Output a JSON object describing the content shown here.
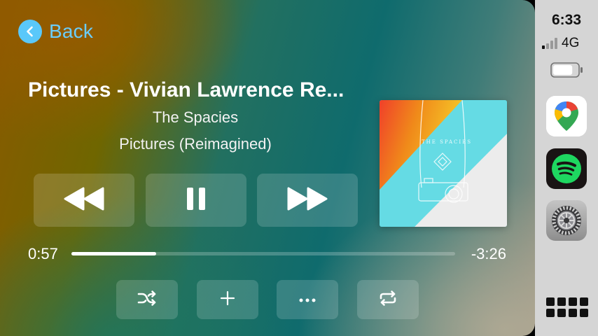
{
  "nav": {
    "back_label": "Back"
  },
  "track": {
    "title": "Pictures - Vivian Lawrence Re...",
    "artist": "The Spacies",
    "album": "Pictures (Reimagined)"
  },
  "artwork": {
    "text": "THE SPACIES"
  },
  "playback": {
    "elapsed": "0:57",
    "remaining": "-3:26",
    "progress_fraction": 0.22,
    "state": "playing"
  },
  "status": {
    "time": "6:33",
    "network": "4G",
    "signal_bars_active": 1,
    "signal_bars_total": 4,
    "battery_level": 0.8
  },
  "controls": {
    "transport": [
      "rewind-icon",
      "pause-icon",
      "fast-forward-icon"
    ],
    "secondary": [
      "shuffle-icon",
      "plus-icon",
      "more-icon",
      "repeat-icon"
    ]
  },
  "dock": {
    "apps": [
      "google-maps-icon",
      "spotify-icon",
      "settings-icon"
    ],
    "launcher_icon": "app-grid-icon"
  },
  "colors": {
    "accent": "#5ac8fa",
    "sidebar_bg": "#d5d5d5",
    "spotify_green": "#1ed760"
  }
}
